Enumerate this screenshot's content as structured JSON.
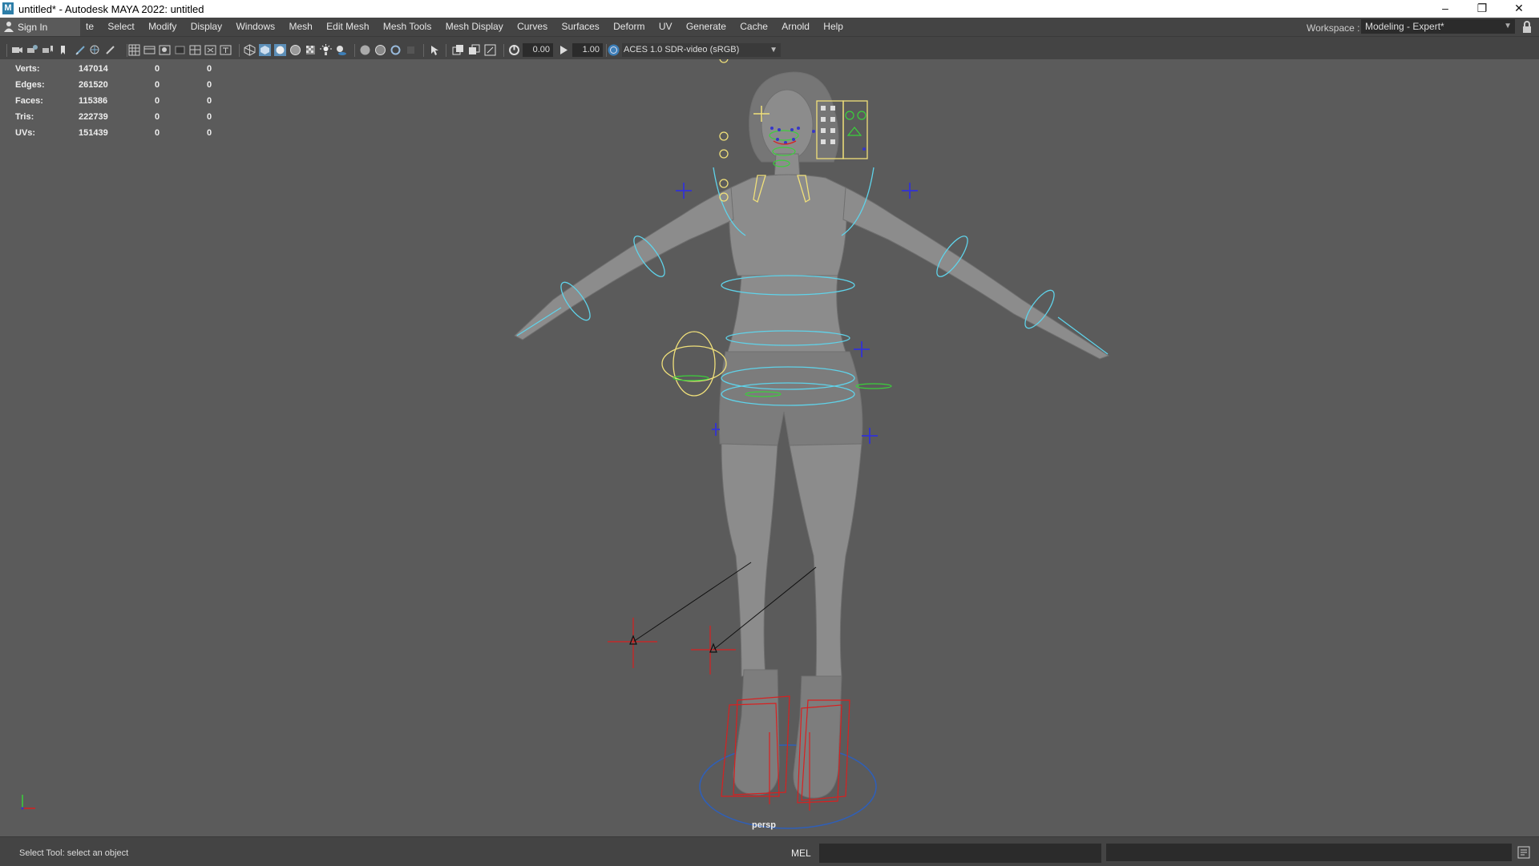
{
  "window": {
    "title": "untitled* - Autodesk MAYA 2022: untitled",
    "app_icon_letter": "M",
    "controls": {
      "minimize": "–",
      "maximize": "❐",
      "close": "✕"
    }
  },
  "menubar": {
    "sign_in": "Sign In",
    "items": [
      "te",
      "Select",
      "Modify",
      "Display",
      "Windows",
      "Mesh",
      "Edit Mesh",
      "Mesh Tools",
      "Mesh Display",
      "Curves",
      "Surfaces",
      "Deform",
      "UV",
      "Generate",
      "Cache",
      "Arnold",
      "Help"
    ],
    "workspace_label": "Workspace :",
    "workspace_value": "Modeling - Expert*"
  },
  "toolbar": {
    "icons": [
      "camera-icon",
      "camera-attr-icon",
      "bookmark-icon",
      "image-plane-icon",
      "grid-icon",
      "film-gate-icon",
      "resolution-gate-icon",
      "gate-mask-icon",
      "field-chart-icon",
      "safe-action-icon",
      "wireframe-icon",
      "smooth-shade-icon",
      "default-material-icon",
      "xray-icon",
      "lights-icon",
      "shadows-icon",
      "isolate-icon",
      "xray-joints-icon",
      "exposure-icon",
      "gamma-icon"
    ],
    "exposure_value": "0.00",
    "gamma_value": "1.00",
    "color_space": "ACES 1.0 SDR-video (sRGB)"
  },
  "hud": {
    "rows": [
      {
        "label": "Verts:",
        "total": "147014",
        "selected": "0",
        "components": "0"
      },
      {
        "label": "Edges:",
        "total": "261520",
        "selected": "0",
        "components": "0"
      },
      {
        "label": "Faces:",
        "total": "115386",
        "selected": "0",
        "components": "0"
      },
      {
        "label": "Tris:",
        "total": "222739",
        "selected": "0",
        "components": "0"
      },
      {
        "label": "UVs:",
        "total": "151439",
        "selected": "0",
        "components": "0"
      }
    ],
    "camera": "persp"
  },
  "scene": {
    "model": "rigged-female-character",
    "colors": {
      "viewport_bg": "#5b5b5b",
      "mesh": "#8c8c8c",
      "ik_ctrl": "#5fd3ea",
      "fk_ctrl": "#f0e07a",
      "face_ctrl": "#3bd03b",
      "locator": "#3636c8",
      "foot_ctrl": "#d82020",
      "world_ctrl": "#2f5fb8"
    }
  },
  "statusbar": {
    "help_line": "Select Tool: select an object",
    "mel_label": "MEL"
  }
}
